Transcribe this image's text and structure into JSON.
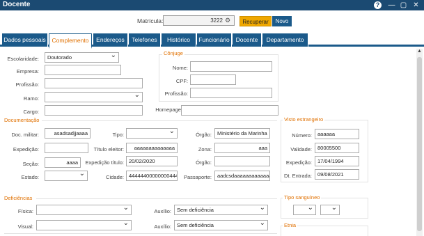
{
  "window": {
    "title": "Docente",
    "help": "?",
    "min": "—",
    "max": "▢",
    "close": "✕"
  },
  "matricula": {
    "label": "Matrícula:",
    "value": "3222",
    "recuperar": "Recuperar",
    "novo": "Novo"
  },
  "tabs": [
    "Dados pessoais",
    "Complemento",
    "Endereços",
    "Telefones",
    "Histórico",
    "Funcionário",
    "Docente",
    "Departamento"
  ],
  "complemento": {
    "escolaridade_label": "Escolaridade:",
    "escolaridade_value": "Doutorado",
    "empresa_label": "Empresa:",
    "profissao_label": "Profissão:",
    "ramo_label": "Ramo:",
    "cargo_label": "Cargo:",
    "homepage_label": "Homepage:"
  },
  "conjuge": {
    "title": "Cônjuge",
    "nome_label": "Nome:",
    "cpf_label": "CPF:",
    "profissao_label": "Profissão:"
  },
  "documentacao": {
    "title": "Documentação",
    "doc_militar_label": "Doc. militar:",
    "doc_militar_value": "asadsadjjaaaa",
    "expedicao_label": "Expedição:",
    "secao_label": "Seção:",
    "secao_value": "aaaa",
    "estado_label": "Estado:",
    "tipo_label": "Tipo:",
    "titulo_eleitor_label": "Título eleitor:",
    "titulo_eleitor_value": "aaaaaaaaaaaaaa",
    "expedicao_titulo_label": "Expedição título:",
    "expedicao_titulo_value": "20/02/2020",
    "cidade_label": "Cidade:",
    "cidade_value": "44444400000000444400",
    "orgao_label": "Órgão:",
    "orgao_value": "Ministério da Marinha",
    "zona_label": "Zona:",
    "zona_value": "aaa",
    "orgao2_label": "Órgão:",
    "passaporte_label": "Passaporte:",
    "passaporte_value": "aadcsdaaaaaaaaaaaaa"
  },
  "visto": {
    "title": "Visto estrangeiro",
    "numero_label": "Número:",
    "numero_value": "aaaaaa",
    "validade_label": "Validade:",
    "validade_value": "80005500",
    "expedicao_label": "Expedição:",
    "expedicao_value": "17/04/1994",
    "entrada_label": "Dt. Entrada:",
    "entrada_value": "09/08/2021"
  },
  "deficiencias": {
    "title": "Deficiências",
    "fisica_label": "Física:",
    "visual_label": "Visual:",
    "auxilio_label": "Auxílio:",
    "auxilio1_value": "Sem deficiência",
    "auxilio2_label": "Auxílio:",
    "auxilio2_value": "Sem deficiência"
  },
  "tipo_sanguineo": {
    "title": "Tipo sanguíneo"
  },
  "etnia": {
    "title": "Etnia"
  },
  "icons": {
    "lookup": "⚙",
    "scroll_up": "▲"
  },
  "colors": {
    "titlebar": "#1b4a72",
    "tab": "#1b5a8a",
    "accent": "#e07000",
    "recuperar": "#f0a800"
  }
}
